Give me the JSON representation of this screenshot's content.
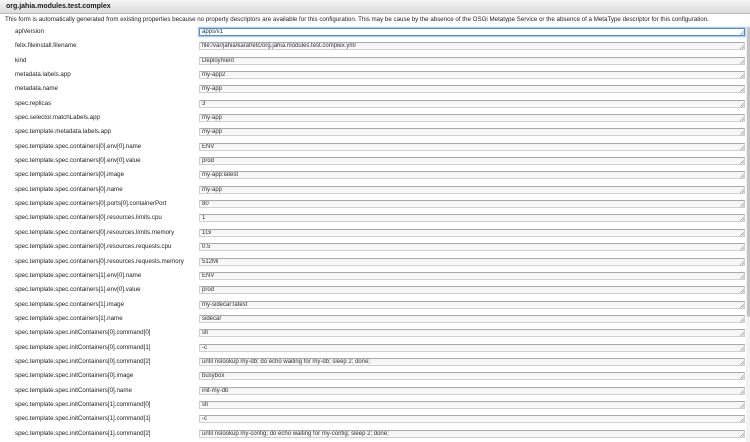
{
  "dialog": {
    "title": "org.jahia.modules.test.complex",
    "notice": "This form is automatically generated from existing properties because no property descriptors are available for this configuration. This may be cause by the absence of the OSGi Metatype Service or the absence of a MetaType descriptor for this configuration."
  },
  "properties": [
    {
      "key": "apiVersion",
      "value": "apps/v1"
    },
    {
      "key": "felix.fileinstall.filename",
      "value": "file:/var/jahia/karaf/etc/org.jahia.modules.test.complex.yml"
    },
    {
      "key": "kind",
      "value": "Deployment"
    },
    {
      "key": "metadata.labels.app",
      "value": "my-app2"
    },
    {
      "key": "metadata.name",
      "value": "my-app"
    },
    {
      "key": "spec.replicas",
      "value": "3"
    },
    {
      "key": "spec.selector.matchLabels.app",
      "value": "my-app"
    },
    {
      "key": "spec.template.metadata.labels.app",
      "value": "my-app"
    },
    {
      "key": "spec.template.spec.containers[0].env[0].name",
      "value": "ENV"
    },
    {
      "key": "spec.template.spec.containers[0].env[0].value",
      "value": "prod"
    },
    {
      "key": "spec.template.spec.containers[0].image",
      "value": "my-app:latest"
    },
    {
      "key": "spec.template.spec.containers[0].name",
      "value": "my-app"
    },
    {
      "key": "spec.template.spec.containers[0].ports[0].containerPort",
      "value": "80"
    },
    {
      "key": "spec.template.spec.containers[0].resources.limits.cpu",
      "value": "1"
    },
    {
      "key": "spec.template.spec.containers[0].resources.limits.memory",
      "value": "1Gi"
    },
    {
      "key": "spec.template.spec.containers[0].resources.requests.cpu",
      "value": "0.5"
    },
    {
      "key": "spec.template.spec.containers[0].resources.requests.memory",
      "value": "512Mi"
    },
    {
      "key": "spec.template.spec.containers[1].env[0].name",
      "value": "ENV"
    },
    {
      "key": "spec.template.spec.containers[1].env[0].value",
      "value": "prod"
    },
    {
      "key": "spec.template.spec.containers[1].image",
      "value": "my-sidecar:latest"
    },
    {
      "key": "spec.template.spec.containers[1].name",
      "value": "sidecar"
    },
    {
      "key": "spec.template.spec.initContainers[0].command[0]",
      "value": "sh"
    },
    {
      "key": "spec.template.spec.initContainers[0].command[1]",
      "value": "-c"
    },
    {
      "key": "spec.template.spec.initContainers[0].command[2]",
      "value": "until nslookup my-db; do echo waiting for my-db; sleep 2; done;"
    },
    {
      "key": "spec.template.spec.initContainers[0].image",
      "value": "busybox"
    },
    {
      "key": "spec.template.spec.initContainers[0].name",
      "value": "init-my-db"
    },
    {
      "key": "spec.template.spec.initContainers[1].command[0]",
      "value": "sh"
    },
    {
      "key": "spec.template.spec.initContainers[1].command[1]",
      "value": "-c"
    },
    {
      "key": "spec.template.spec.initContainers[1].command[2]",
      "value": "until nslookup my-config; do echo waiting for my-config; sleep 2; done;"
    }
  ],
  "colors": {
    "focus_border": "#4d90d6",
    "titlebar": "#dcdcdc"
  }
}
